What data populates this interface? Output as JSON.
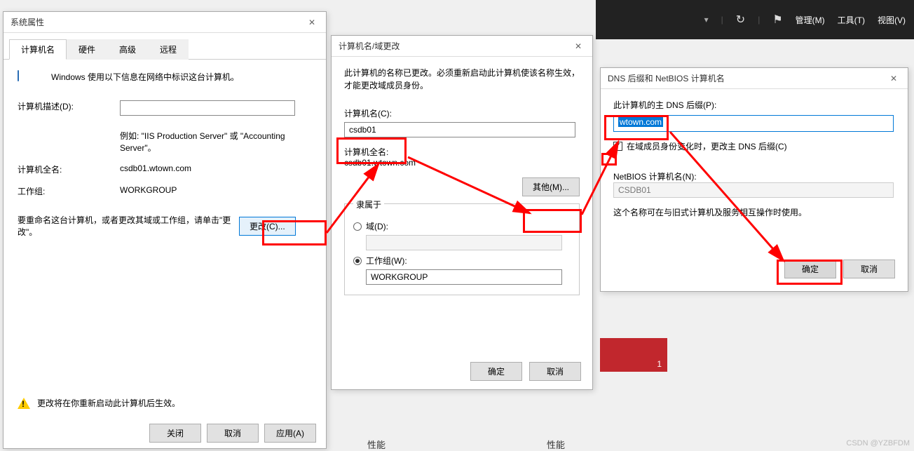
{
  "topbar": {
    "refresh_icon": "↻",
    "flag_icon": "⚑",
    "manage": "管理(M)",
    "tools": "工具(T)",
    "view": "视图(V)"
  },
  "dialog1": {
    "title": "系统属性",
    "tabs": {
      "computer_name": "计算机名",
      "hardware": "硬件",
      "advanced": "高级",
      "remote": "远程"
    },
    "intro": "Windows 使用以下信息在网络中标识这台计算机。",
    "desc_label": "计算机描述(D):",
    "desc_value": "",
    "desc_hint": "例如: \"IIS Production Server\" 或 \"Accounting Server\"。",
    "fullname_label": "计算机全名:",
    "fullname_value": "csdb01.wtown.com",
    "workgroup_label": "工作组:",
    "workgroup_value": "WORKGROUP",
    "rename_text": "要重命名这台计算机，或者更改其域或工作组，请单击\"更改\"。",
    "change_btn": "更改(C)...",
    "warn_text": "更改将在你重新启动此计算机后生效。",
    "close_btn": "关闭",
    "cancel_btn": "取消",
    "apply_btn": "应用(A)"
  },
  "dialog2": {
    "title": "计算机名/域更改",
    "intro": "此计算机的名称已更改。必须重新启动此计算机使该名称生效，才能更改域成员身份。",
    "name_label": "计算机名(C):",
    "name_value": "csdb01",
    "full_label": "计算机全名:",
    "full_value": "csdb01.wtown.com",
    "other_btn": "其他(M)...",
    "member_of": "隶属于",
    "domain_label": "域(D):",
    "domain_value": "",
    "workgroup_label": "工作组(W):",
    "workgroup_value": "WORKGROUP",
    "ok_btn": "确定",
    "cancel_btn": "取消"
  },
  "dialog3": {
    "title": "DNS 后缀和 NetBIOS 计算机名",
    "suffix_label": "此计算机的主 DNS 后缀(P):",
    "suffix_value": "wtown.com",
    "checkbox_label": "在域成员身份变化时，更改主 DNS 后缀(C)",
    "netbios_label": "NetBIOS 计算机名(N):",
    "netbios_value": "CSDB01",
    "note": "这个名称可在与旧式计算机及服务相互操作时使用。",
    "ok_btn": "确定",
    "cancel_btn": "取消"
  },
  "redtile": {
    "count": "1"
  },
  "perf_label": "性能",
  "watermark": "CSDN @YZBFDM"
}
